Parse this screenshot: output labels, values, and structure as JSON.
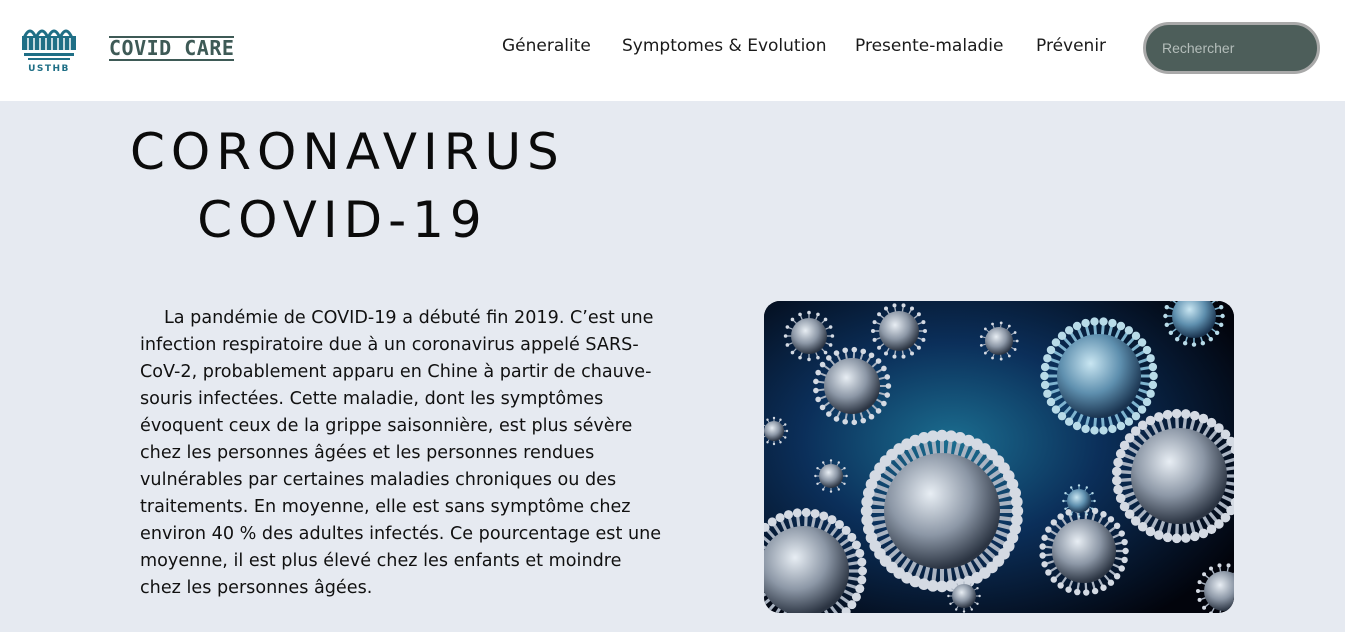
{
  "header": {
    "logo_text": "USTHB",
    "brand_name": "COVID CARE",
    "nav": [
      {
        "label": "Géneralite"
      },
      {
        "label": "Symptomes & Evolution"
      },
      {
        "label": "Presente-maladie"
      },
      {
        "label": "Prévenir"
      }
    ],
    "search": {
      "placeholder": "Rechercher",
      "value": ""
    }
  },
  "hero": {
    "title_line1": "CORONAVIRUS",
    "title_line2": "COVID-19"
  },
  "intro": {
    "paragraph": "La pandémie de COVID-19 a débuté fin 2019. C’est une infection respiratoire due à un coronavirus appelé SARS-CoV-2, probablement apparu en Chine à partir de chauve-souris infectées. Cette maladie, dont les symptômes évoquent ceux de la grippe saisonnière, est plus sévère chez les personnes âgées et les personnes rendues vulnérables par certaines maladies chroniques ou des traitements. En moyenne, elle est sans symptôme chez environ 40 % des adultes infectés. Ce pourcentage est une moyenne, il est plus élevé chez les enfants et moindre chez les personnes âgées."
  },
  "colors": {
    "page_bg": "#e6eaf1",
    "brand": "#3e5a56",
    "search_bg": "#4d5e5a",
    "image_bg": "#03060f"
  },
  "icons": {
    "logo": "usthb-logo-icon",
    "virus": "coronavirus-image"
  }
}
